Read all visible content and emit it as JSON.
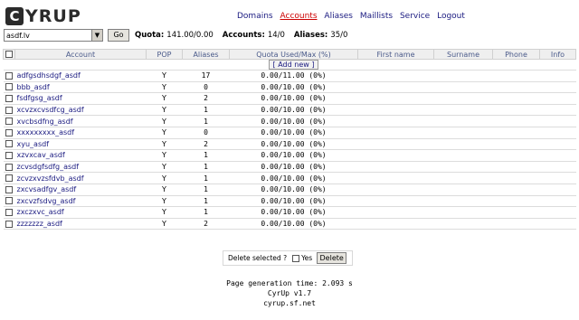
{
  "logo": {
    "badge": "C",
    "text": "YRUP"
  },
  "nav": {
    "items": [
      {
        "label": "Domains"
      },
      {
        "label": "Accounts"
      },
      {
        "label": "Aliases"
      },
      {
        "label": "Maillists"
      },
      {
        "label": "Service"
      },
      {
        "label": "Logout"
      }
    ],
    "active": "Accounts"
  },
  "domain_bar": {
    "selected": "asdf.lv",
    "go_label": "Go",
    "quota_label": "Quota:",
    "quota_value": "141.00/0.00",
    "accounts_label": "Accounts:",
    "accounts_value": "14/0",
    "aliases_label": "Aliases:",
    "aliases_value": "35/0"
  },
  "table": {
    "headers": [
      "Account",
      "POP",
      "Aliases",
      "Quota Used/Max (%)",
      "First name",
      "Surname",
      "Phone",
      "Info"
    ],
    "add_new_label": "[ Add new ]",
    "rows": [
      {
        "account": "adfgsdhsdgf_asdf",
        "pop": "Y",
        "aliases": "17",
        "quota": "0.00/11.00 (0%)"
      },
      {
        "account": "bbb_asdf",
        "pop": "Y",
        "aliases": "0",
        "quota": "0.00/10.00 (0%)"
      },
      {
        "account": "fsdfgsg_asdf",
        "pop": "Y",
        "aliases": "2",
        "quota": "0.00/10.00 (0%)"
      },
      {
        "account": "xcvzxcvsdfcg_asdf",
        "pop": "Y",
        "aliases": "1",
        "quota": "0.00/10.00 (0%)"
      },
      {
        "account": "xvcbsdfng_asdf",
        "pop": "Y",
        "aliases": "1",
        "quota": "0.00/10.00 (0%)"
      },
      {
        "account": "xxxxxxxxx_asdf",
        "pop": "Y",
        "aliases": "0",
        "quota": "0.00/10.00 (0%)"
      },
      {
        "account": "xyu_asdf",
        "pop": "Y",
        "aliases": "2",
        "quota": "0.00/10.00 (0%)"
      },
      {
        "account": "xzvxcav_asdf",
        "pop": "Y",
        "aliases": "1",
        "quota": "0.00/10.00 (0%)"
      },
      {
        "account": "zcvsdgfsdfg_asdf",
        "pop": "Y",
        "aliases": "1",
        "quota": "0.00/10.00 (0%)"
      },
      {
        "account": "zcvzxvzsfdvb_asdf",
        "pop": "Y",
        "aliases": "1",
        "quota": "0.00/10.00 (0%)"
      },
      {
        "account": "zxcvsadfgv_asdf",
        "pop": "Y",
        "aliases": "1",
        "quota": "0.00/10.00 (0%)"
      },
      {
        "account": "zxcvzfsdvg_asdf",
        "pop": "Y",
        "aliases": "1",
        "quota": "0.00/10.00 (0%)"
      },
      {
        "account": "zxczxvc_asdf",
        "pop": "Y",
        "aliases": "1",
        "quota": "0.00/10.00 (0%)"
      },
      {
        "account": "zzzzzzz_asdf",
        "pop": "Y",
        "aliases": "2",
        "quota": "0.00/10.00 (0%)"
      }
    ]
  },
  "delete_bar": {
    "label": "Delete selected ?",
    "yes_label": "Yes",
    "button_label": "Delete"
  },
  "footer": {
    "generation": "Page generation time: 2.093 s",
    "version": "CyrUp v1.7",
    "site": "cyrup.sf.net"
  },
  "colors": {
    "link": "#1a1a80",
    "active_nav": "#cc0000",
    "header_bg": "#efefef"
  }
}
